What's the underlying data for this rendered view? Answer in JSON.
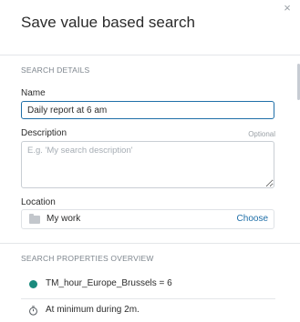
{
  "dialog": {
    "title": "Save value based search",
    "close_label": "×"
  },
  "search_details": {
    "section_label": "SEARCH DETAILS",
    "name": {
      "label": "Name",
      "value": "Daily report at 6 am"
    },
    "description": {
      "label": "Description",
      "optional_label": "Optional",
      "value": "",
      "placeholder": "E.g. 'My search description'"
    },
    "location": {
      "label": "Location",
      "value": "My work",
      "choose_label": "Choose"
    }
  },
  "properties_overview": {
    "section_label": "SEARCH PROPERTIES OVERVIEW",
    "items": [
      {
        "icon": "status-dot-icon",
        "text": "TM_hour_Europe_Brussels = 6"
      },
      {
        "icon": "timer-icon",
        "text": "At minimum during 2m."
      }
    ]
  },
  "colors": {
    "accent": "#1f6fa8",
    "status_dot": "#1a8a7d"
  }
}
